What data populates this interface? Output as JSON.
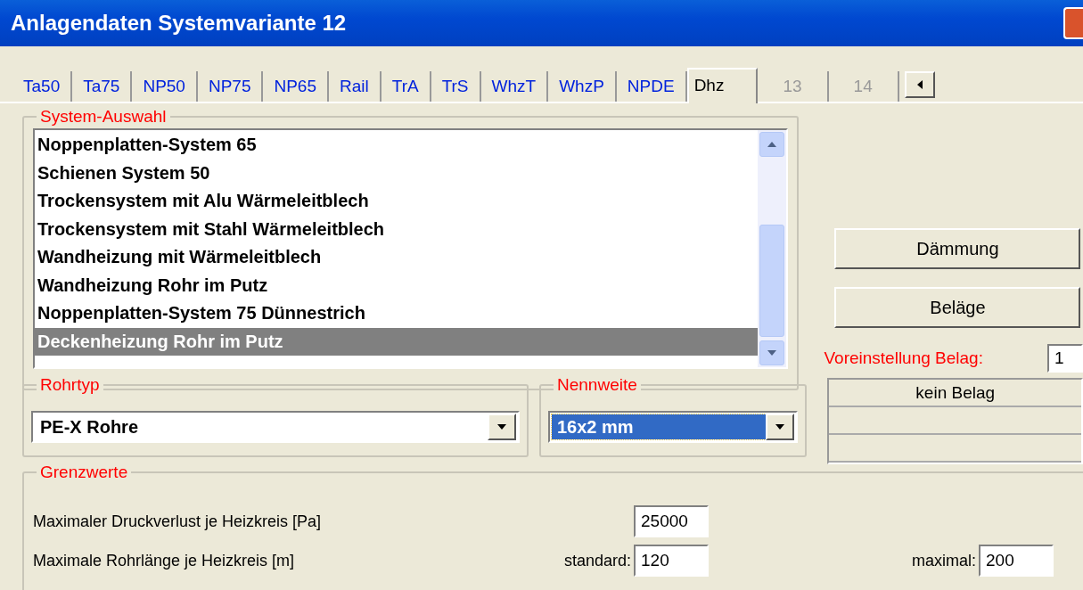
{
  "window": {
    "title": "Anlagendaten Systemvariante 12"
  },
  "tabs": [
    {
      "label": "Ta50",
      "selected": false,
      "disabled": false
    },
    {
      "label": "Ta75",
      "selected": false,
      "disabled": false
    },
    {
      "label": "NP50",
      "selected": false,
      "disabled": false
    },
    {
      "label": "NP75",
      "selected": false,
      "disabled": false
    },
    {
      "label": "NP65",
      "selected": false,
      "disabled": false
    },
    {
      "label": "Rail",
      "selected": false,
      "disabled": false
    },
    {
      "label": "TrA",
      "selected": false,
      "disabled": false
    },
    {
      "label": "TrS",
      "selected": false,
      "disabled": false
    },
    {
      "label": "WhzT",
      "selected": false,
      "disabled": false
    },
    {
      "label": "WhzP",
      "selected": false,
      "disabled": false
    },
    {
      "label": "NPDE",
      "selected": false,
      "disabled": false
    },
    {
      "label": "Dhz",
      "selected": true,
      "disabled": false
    },
    {
      "label": "13",
      "selected": false,
      "disabled": true
    },
    {
      "label": "14",
      "selected": false,
      "disabled": true
    }
  ],
  "system_selection": {
    "legend": "System-Auswahl",
    "items": [
      {
        "label": "Noppenplatten-System 65",
        "selected": false
      },
      {
        "label": "Schienen System 50",
        "selected": false
      },
      {
        "label": "Trockensystem mit Alu Wärmeleitblech",
        "selected": false
      },
      {
        "label": "Trockensystem mit Stahl Wärmeleitblech",
        "selected": false
      },
      {
        "label": "Wandheizung mit Wärmeleitblech",
        "selected": false
      },
      {
        "label": "Wandheizung Rohr im Putz",
        "selected": false
      },
      {
        "label": "Noppenplatten-System 75 Dünnestrich",
        "selected": false
      },
      {
        "label": "Deckenheizung Rohr im Putz",
        "selected": true
      }
    ]
  },
  "buttons": [
    "Dämmung",
    "Beläge"
  ],
  "default_covering": {
    "label": "Voreinstellung Belag:",
    "value": "1"
  },
  "covering_list": {
    "rows": [
      "kein Belag"
    ]
  },
  "pipe_type": {
    "legend": "Rohrtyp",
    "value": "PE-X Rohre",
    "focused": false
  },
  "nominal_size": {
    "legend": "Nennweite",
    "value": "16x2 mm",
    "focused": true
  },
  "limits": {
    "legend": "Grenzwerte",
    "rows": [
      {
        "label": "Maximaler Druckverlust je Heizkreis [Pa]",
        "fields": [
          {
            "value": "25000"
          }
        ]
      },
      {
        "label": "Maximale Rohrlänge je Heizkreis [m]",
        "fields": [
          {
            "label": "standard:",
            "value": "120"
          },
          {
            "label": "maximal:",
            "value": "200"
          }
        ]
      }
    ]
  }
}
